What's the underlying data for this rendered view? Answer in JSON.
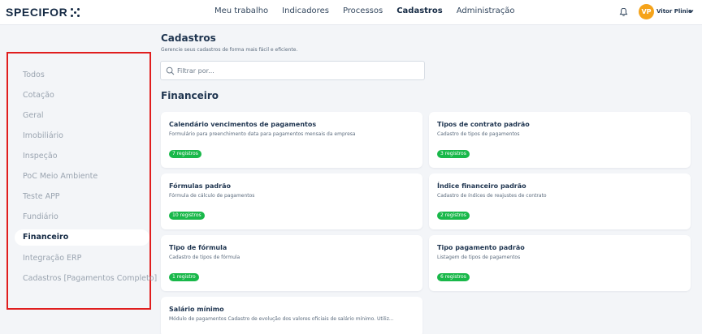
{
  "header": {
    "logo": "SPECIFOR",
    "nav": [
      {
        "label": "Meu trabalho",
        "active": false
      },
      {
        "label": "Indicadores",
        "active": false
      },
      {
        "label": "Processos",
        "active": false
      },
      {
        "label": "Cadastros",
        "active": true
      },
      {
        "label": "Administração",
        "active": false
      }
    ],
    "user": {
      "initials": "VP",
      "name": "Vitor Plinio",
      "avatar_color": "#f5a31a"
    },
    "icons": {
      "notifications": "bell-icon",
      "user_menu": "chevron-down-icon",
      "search": "search-icon"
    }
  },
  "sidebar": {
    "highlight_color": "#e01e1e",
    "items": [
      {
        "label": "Todos",
        "active": false
      },
      {
        "label": "Cotação",
        "active": false
      },
      {
        "label": "Geral",
        "active": false
      },
      {
        "label": "Imobiliário",
        "active": false
      },
      {
        "label": "Inspeção",
        "active": false
      },
      {
        "label": "PoC Meio Ambiente",
        "active": false
      },
      {
        "label": "Teste APP",
        "active": false
      },
      {
        "label": "Fundiário",
        "active": false
      },
      {
        "label": "Financeiro",
        "active": true
      },
      {
        "label": "Integração ERP",
        "active": false
      },
      {
        "label": "Cadastros [Pagamentos Completo]",
        "active": false
      }
    ]
  },
  "main": {
    "title": "Cadastros",
    "subtitle": "Gerencie seus cadastros de forma mais fácil e eficiente.",
    "search": {
      "placeholder": "Filtrar por...",
      "value": ""
    },
    "section_title": "Financeiro",
    "badge_color": "#19b84a",
    "cards": [
      {
        "title": "Calendário vencimentos de pagamentos",
        "description": "Formulário para preenchimento data para pagamentos mensais da empresa",
        "badge": "7 registros"
      },
      {
        "title": "Tipos de contrato padrão",
        "description": "Cadastro de tipos de pagamentos",
        "badge": "3 registros"
      },
      {
        "title": "Fórmulas padrão",
        "description": "Fórmula de cálculo de pagamentos",
        "badge": "10 registros"
      },
      {
        "title": "Índice financeiro padrão",
        "description": "Cadastro de índices de reajustes de contrato",
        "badge": "2 registros"
      },
      {
        "title": "Tipo de fórmula",
        "description": "Cadastro de tipos de fórmula",
        "badge": "1 registro"
      },
      {
        "title": "Tipo pagamento padrão",
        "description": "Listagem de tipos de pagamentos",
        "badge": "6 registros"
      },
      {
        "title": "Salário mínimo",
        "description": "Módulo de pagamentos Cadastro de evolução dos valores oficiais de salário mínimo. Utiliz...",
        "badge": null
      }
    ]
  }
}
